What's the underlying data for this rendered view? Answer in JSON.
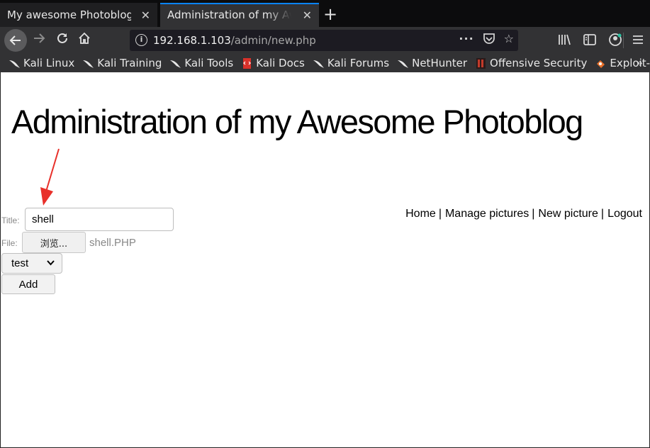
{
  "browser": {
    "tabs": [
      {
        "title": "My awesome Photoblog",
        "active": false
      },
      {
        "title": "Administration of my Awesome Photoblog",
        "active": true
      }
    ],
    "url": {
      "host": "192.168.1.103",
      "path": "/admin/new.php"
    },
    "bookmarks": [
      {
        "label": "Kali Linux",
        "icon": "kali-dragon-icon"
      },
      {
        "label": "Kali Training",
        "icon": "kali-dragon-icon"
      },
      {
        "label": "Kali Tools",
        "icon": "kali-dragon-icon"
      },
      {
        "label": "Kali Docs",
        "icon": "kali-docs-icon"
      },
      {
        "label": "Kali Forums",
        "icon": "kali-dragon-icon"
      },
      {
        "label": "NetHunter",
        "icon": "kali-dragon-icon"
      },
      {
        "label": "Offensive Security",
        "icon": "offsec-icon"
      },
      {
        "label": "Exploit-DB",
        "icon": "exploit-db-icon"
      }
    ]
  },
  "page": {
    "title": "Administration of my Awesome Photoblog",
    "nav": [
      "Home",
      "Manage pictures",
      "New picture",
      "Logout"
    ],
    "form": {
      "title_label": "Title:",
      "title_value": "shell",
      "file_label": "File:",
      "browse_label": "浏览...",
      "file_name": "shell.PHP",
      "category_selected": "test",
      "submit_label": "Add"
    }
  },
  "colors": {
    "tab_active_indicator": "#0a84ff",
    "annotation_arrow": "#e8302a",
    "chrome_background": "#323234"
  }
}
